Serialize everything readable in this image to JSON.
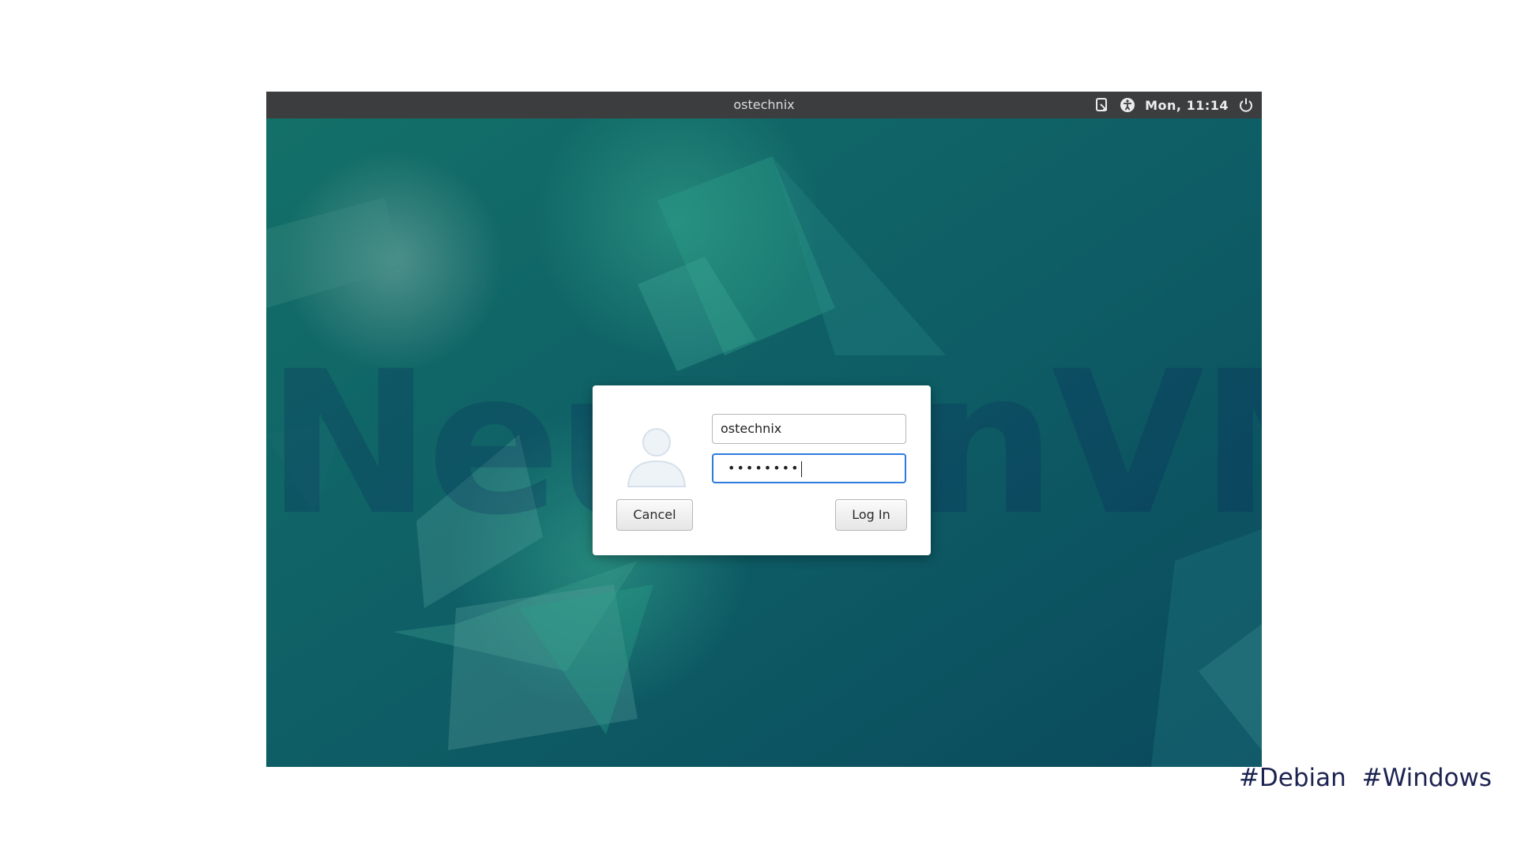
{
  "topbar": {
    "hostname": "ostechnix",
    "clock": "Mon, 11:14",
    "icons": [
      "clipboard-icon",
      "accessibility-icon",
      "power-icon"
    ]
  },
  "watermark": "NeuronVM",
  "login_dialog": {
    "username": "ostechnix",
    "password_masked": "••••••••",
    "cancel_label": "Cancel",
    "login_label": "Log In",
    "avatar_icon": "user-avatar-icon"
  },
  "footer": {
    "tags": "#Debian  #Windows"
  },
  "colors": {
    "desktop_bg": "#0b4f60",
    "topbar_bg": "#3b3d3f",
    "focus_border": "#2e7be0",
    "tag_text": "#1c2350"
  }
}
